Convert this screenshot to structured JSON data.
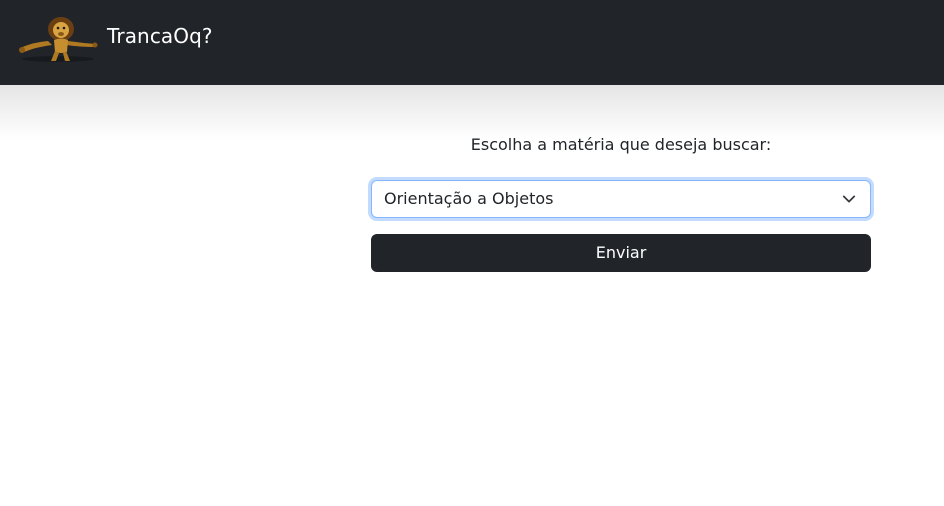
{
  "navbar": {
    "brand_name": "TrancaOq?",
    "logo_icon": "lion-mascot-icon",
    "background_color": "#212529"
  },
  "form": {
    "label": "Escolha a matéria que deseja buscar:",
    "select": {
      "selected_value": "Orientação a Objetos",
      "icon": "chevron-down-icon",
      "focus_color": "#86b7fe"
    },
    "submit_label": "Enviar",
    "submit_color": "#212529"
  }
}
